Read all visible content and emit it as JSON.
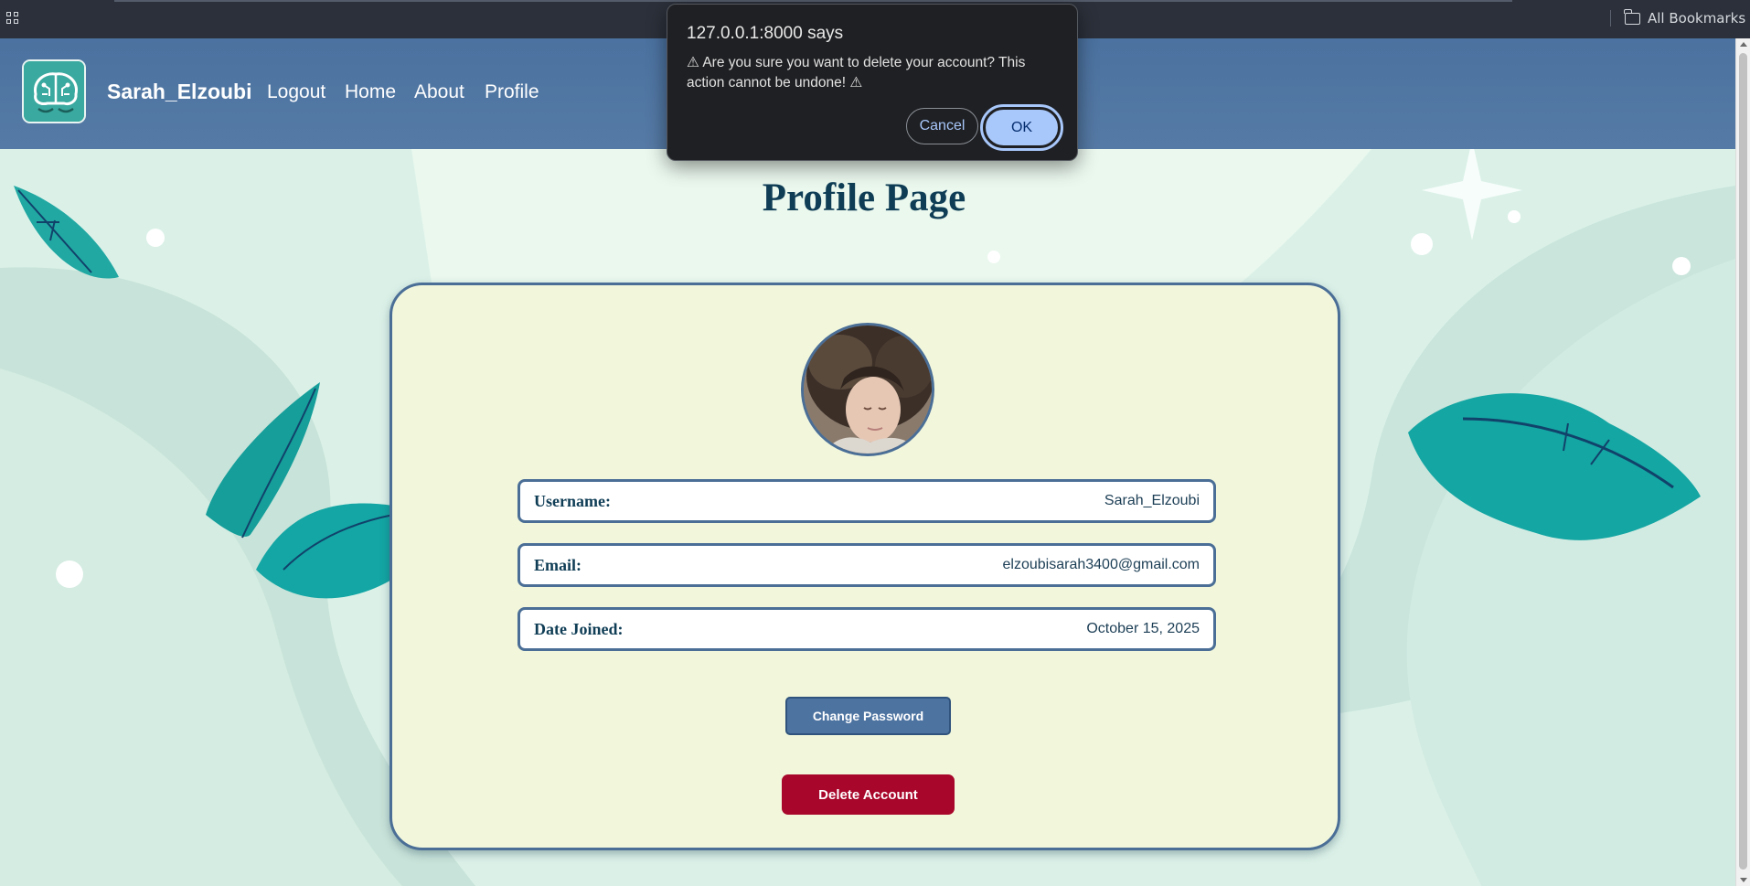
{
  "browser": {
    "bookmarks_label": "All Bookmarks"
  },
  "navbar": {
    "brand": "Sarah_Elzoubi",
    "links": [
      "Logout",
      "Home",
      "About",
      "Profile"
    ]
  },
  "page": {
    "title": "Profile Page"
  },
  "profile": {
    "fields": [
      {
        "label": "Username:",
        "value": "Sarah_Elzoubi"
      },
      {
        "label": "Email:",
        "value": "elzoubisarah3400@gmail.com"
      },
      {
        "label": "Date Joined:",
        "value": "October 15, 2025"
      }
    ],
    "change_password_label": "Change Password",
    "delete_account_label": "Delete Account"
  },
  "alert": {
    "title": "127.0.0.1:8000 says",
    "message": "⚠ Are you sure you want to delete your account? This action cannot be undone! ⚠",
    "cancel_label": "Cancel",
    "ok_label": "OK"
  },
  "colors": {
    "navbar": "#4b72a0",
    "accent_dark": "#0f3d55",
    "card_bg": "#f2f7dc",
    "delete_red": "#a8062a",
    "alert_ok": "#a8c7fa"
  }
}
